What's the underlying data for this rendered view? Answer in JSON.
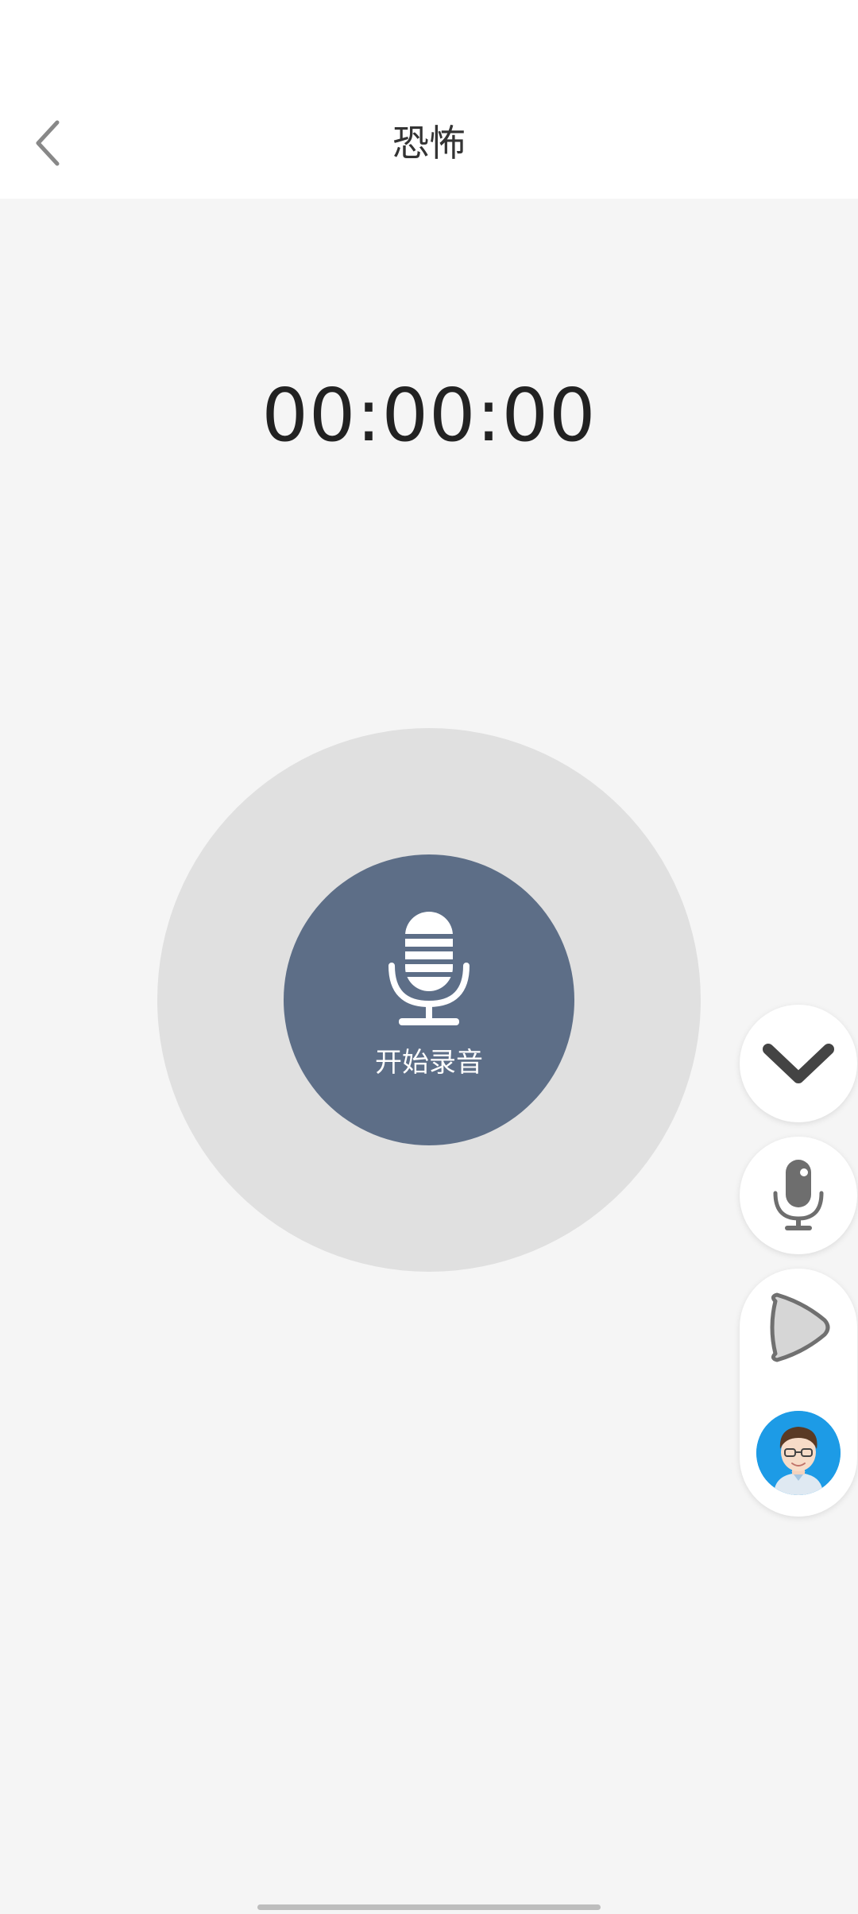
{
  "header": {
    "title": "恐怖",
    "back_icon": "chevron-left-icon"
  },
  "recorder": {
    "elapsed_time": "00:00:00",
    "record_label": "开始录音",
    "record_icon": "microphone-icon",
    "button_color": "#5d6e87",
    "ring_color": "#e0e0e0"
  },
  "floating_menu": {
    "collapse_icon": "chevron-down-icon",
    "mic_icon": "microphone-icon",
    "play_icon": "play-icon",
    "avatar_icon": "avatar-icon",
    "avatar_bg": "#1d9be6"
  }
}
